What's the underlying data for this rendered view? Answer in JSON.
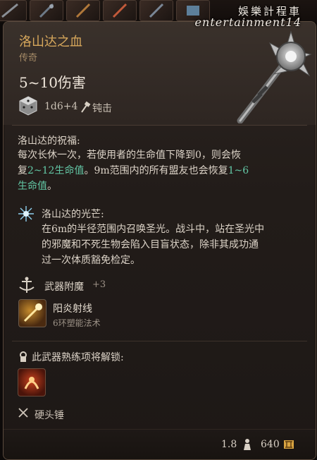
{
  "watermark": {
    "line1": "娛樂計程車",
    "line2": "entertainment14"
  },
  "item": {
    "name": "洛山达之血",
    "rarity": "传奇",
    "damage": "5~10伤害",
    "dice": "1d6+4",
    "damage_type": "钝击"
  },
  "blessing": {
    "title": "洛山达的祝福:",
    "line1": "每次长休一次，若使用者的生命值下降到0，则会恢",
    "line2_a": "复",
    "line2_hl1": "2~12生命值",
    "line2_b": "。9m范围内的所有盟友也会恢复",
    "line2_hl2": "1~6",
    "line3_hl": "生命值",
    "line3_b": "。"
  },
  "radiance": {
    "title": "洛山达的光芒:",
    "lines": [
      "在6m的半径范围内召唤圣光。战斗中，站在圣光中",
      "的邪魔和不死生物会陷入目盲状态，除非其成功通",
      "过一次体质豁免检定。"
    ]
  },
  "enchant": {
    "label": "武器附魔",
    "value": "+3"
  },
  "spell": {
    "name": "阳炎射线",
    "sub": "6环塑能法术"
  },
  "unlock": {
    "label": "此武器熟练项将解锁:"
  },
  "proficiency": {
    "label": "硬头锤"
  },
  "footer": {
    "weight": "1.8",
    "price": "640"
  },
  "colors": {
    "title": "#d8a85c",
    "highlight": "#63c7a5",
    "text": "#ddd4c8"
  }
}
